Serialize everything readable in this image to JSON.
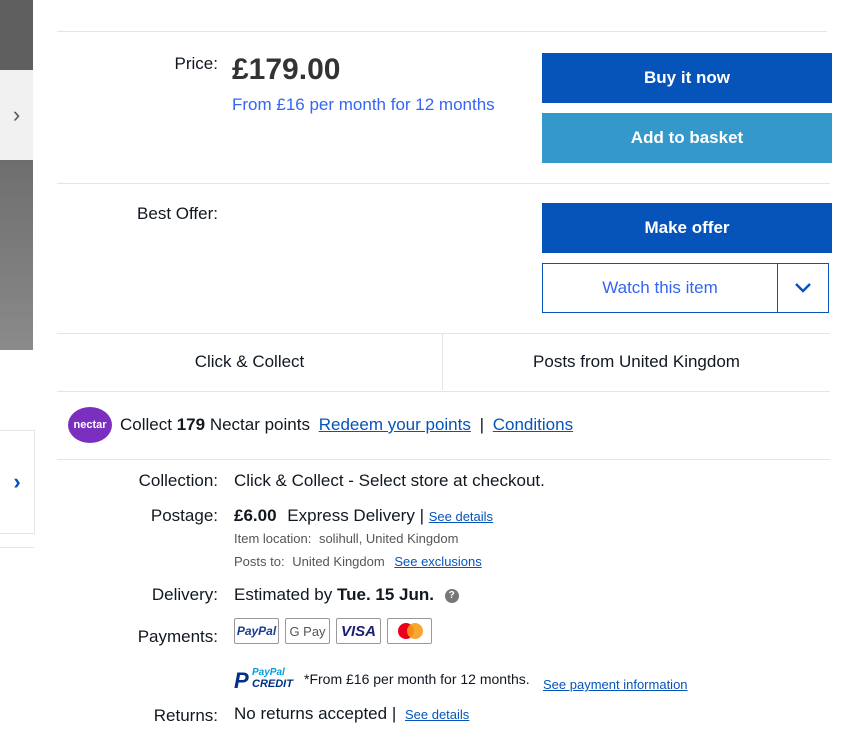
{
  "price": {
    "label": "Price:",
    "amount": "£179.00",
    "finance": "From £16 per month for 12 months"
  },
  "buttons": {
    "buy_now": "Buy it now",
    "add_to_basket": "Add to basket",
    "make_offer": "Make offer",
    "watch": "Watch this item"
  },
  "best_offer": {
    "label": "Best Offer:"
  },
  "delivery_options": {
    "collect": "Click & Collect",
    "posts_from": "Posts from United Kingdom"
  },
  "nectar": {
    "logo_text": "nectar",
    "collect_prefix": "Collect",
    "points": "179",
    "collect_suffix": "Nectar points",
    "redeem_link": "Redeem your points",
    "separator": "|",
    "conditions_link": "Conditions"
  },
  "shipping": {
    "collection_label": "Collection:",
    "collection_value": "Click & Collect - Select store at checkout.",
    "postage_label": "Postage:",
    "postage_price": "£6.00",
    "postage_service": "Express Delivery",
    "postage_sep": "|",
    "see_details": "See details",
    "item_location_label": "Item location:",
    "item_location_value": "solihull, United Kingdom",
    "posts_to_label": "Posts to:",
    "posts_to_value": "United Kingdom",
    "see_exclusions": "See exclusions",
    "delivery_label": "Delivery:",
    "delivery_prefix": "Estimated by",
    "delivery_date": "Tue. 15 Jun.",
    "payments_label": "Payments:",
    "payment_logos": [
      "PayPal",
      "G Pay",
      "VISA",
      "mastercard"
    ],
    "credit_logo_line1": "PayPal",
    "credit_logo_line2": "CREDIT",
    "credit_text": "*From £16 per month for 12 months.",
    "see_payment_info": "See payment information",
    "returns_label": "Returns:",
    "returns_value": "No returns accepted",
    "returns_sep": "|",
    "returns_see_details": "See details"
  },
  "colors": {
    "primary_button": "#0654ba",
    "secondary_button": "#3498ca",
    "link": "#0654ba",
    "finance_text": "#3665f3",
    "nectar_purple": "#7b2fbe"
  }
}
